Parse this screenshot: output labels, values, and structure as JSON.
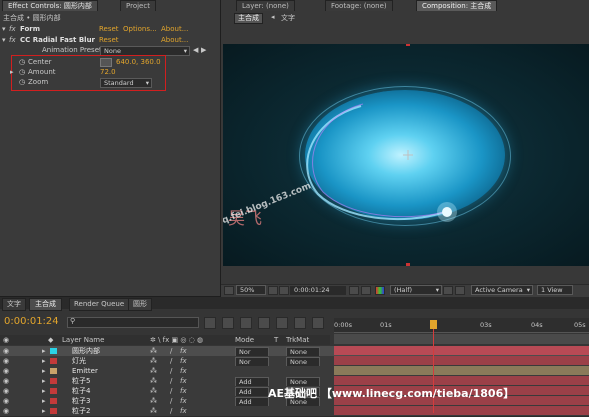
{
  "effect_panel": {
    "tabs": [
      "Effect Controls: 圆形内部",
      "Project"
    ],
    "subtitle": "主合成 • 圆形内部",
    "form": {
      "label": "Form",
      "reset": "Reset",
      "options": "Options...",
      "about": "About..."
    },
    "radial": {
      "label": "CC Radial Fast Blur",
      "reset": "Reset",
      "about": "About..."
    },
    "presets": {
      "label": "Animation Presets:",
      "value": "None"
    },
    "center": {
      "label": "Center",
      "value": "640.0, 360.0"
    },
    "amount": {
      "label": "Amount",
      "value": "72.0"
    },
    "zoom": {
      "label": "Zoom",
      "value": "Standard"
    }
  },
  "viewer": {
    "top_tabs": [
      "Layer: (none)",
      "Footage: (none)",
      "Composition: 主合成"
    ],
    "sub_tabs": [
      "主合成",
      "文字"
    ],
    "watermark_cn": "吴飞",
    "watermark_url": "wq.fei.blog.163.com",
    "toolbar": {
      "zoom": "50%",
      "time": "0:00:01:24",
      "resolution": "(Half)",
      "camera": "Active Camera",
      "views": "1 View"
    }
  },
  "timeline": {
    "tabs": [
      "文字",
      "主合成",
      "Render Queue",
      "圆形"
    ],
    "time": "0:00:01:24",
    "ruler": [
      "0:00s",
      "01s",
      "03s",
      "04s",
      "05s"
    ],
    "columns": {
      "layer_name": "Layer Name",
      "mode": "Mode",
      "t": "T",
      "trkmat": "TrkMat"
    },
    "layers": [
      {
        "num": "1",
        "name": "圆形内部",
        "color": "#2bd2e6",
        "mode": "Nor",
        "trkmat": "None",
        "selected": true
      },
      {
        "num": "2",
        "name": "灯光",
        "color": "#c23a3a",
        "mode": "Nor",
        "trkmat": "None",
        "selected": false
      },
      {
        "num": "3",
        "name": "Emitter",
        "color": "#c9a36a",
        "mode": "",
        "trkmat": "",
        "selected": false
      },
      {
        "num": "4",
        "name": "粒子5",
        "color": "#c23a3a",
        "mode": "Add",
        "trkmat": "None",
        "selected": false
      },
      {
        "num": "5",
        "name": "粒子4",
        "color": "#c23a3a",
        "mode": "Add",
        "trkmat": "None",
        "selected": false
      },
      {
        "num": "6",
        "name": "粒子3",
        "color": "#c23a3a",
        "mode": "Add",
        "trkmat": "None",
        "selected": false
      },
      {
        "num": "7",
        "name": "粒子2",
        "color": "#c23a3a",
        "mode": "",
        "trkmat": "",
        "selected": false
      }
    ]
  },
  "footer_watermark": {
    "brand": "AE基础吧",
    "url": "【www.linecg.com/tieba/1806】"
  },
  "colors": {
    "accent": "#e2a52c",
    "highlight_box": "#d21f1f",
    "playhead": "#d43c3c"
  }
}
